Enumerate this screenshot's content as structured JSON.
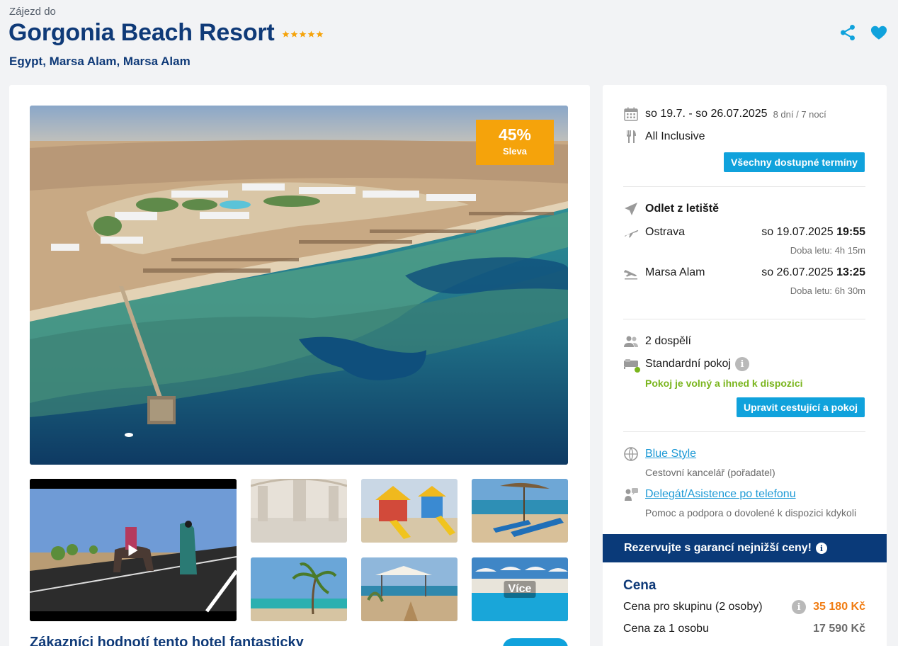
{
  "header": {
    "pre_title": "Zájezd do",
    "title": "Gorgonia Beach Resort",
    "stars": 5,
    "location": "Egypt, Marsa Alam, Marsa Alam"
  },
  "icons": {
    "share": "share-icon",
    "favorite": "heart-icon",
    "calendar": "calendar-icon",
    "meal": "fork-knife-icon",
    "plane": "plane-icon",
    "takeoff": "takeoff-icon",
    "landing": "landing-icon",
    "people": "people-icon",
    "bed": "bed-icon",
    "globe": "globe-icon",
    "support": "support-icon"
  },
  "gallery": {
    "discount_pct": "45%",
    "discount_label": "Sleva",
    "more_label": "Více"
  },
  "reviews": {
    "title": "Zákazníci hodnotí tento hotel fantasticky"
  },
  "booking": {
    "dates": "so 19.7. - so 26.07.2025",
    "duration": "8 dní / 7 nocí",
    "board": "All Inclusive",
    "all_dates_button": "Všechny dostupné termíny",
    "departure_heading": "Odlet z letiště",
    "outbound": {
      "from": "Ostrava",
      "date": "so 19.07.2025",
      "time": "19:55",
      "flight_time": "Doba letu: 4h 15m"
    },
    "inbound": {
      "from": "Marsa Alam",
      "date": "so 26.07.2025",
      "time": "13:25",
      "flight_time": "Doba letu: 6h 30m"
    },
    "travellers": "2 dospělí",
    "room": "Standardní pokoj",
    "room_status": "Pokoj je volný a ihned k dispozici",
    "edit_button": "Upravit cestující a pokoj",
    "organizer_name": "Blue Style",
    "organizer_role": "Cestovní kancelář (pořadatel)",
    "assist_name": "Delegát/Asistence po telefonu",
    "assist_desc": "Pomoc a podpora o dovolené k dispozici kdykoli",
    "guarantee": "Rezervujte s garancí nejnižší ceny!",
    "price_heading": "Cena",
    "group_price_label": "Cena pro skupinu (2 osoby)",
    "group_price": "35 180 Kč",
    "person_price_label": "Cena za 1 osobu",
    "person_price": "17 590 Kč"
  },
  "colors": {
    "brand_blue": "#0f3a78",
    "accent": "#10a2dc",
    "discount": "#f5a30b",
    "price": "#f07c12",
    "available": "#7ab51d"
  }
}
